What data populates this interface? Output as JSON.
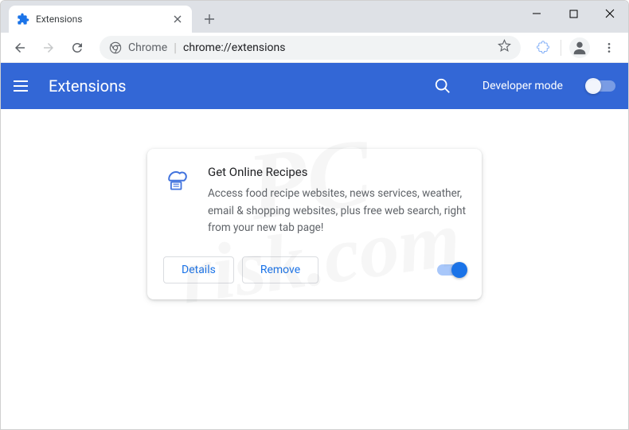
{
  "window": {
    "tab_title": "Extensions"
  },
  "omnibox": {
    "origin_label": "Chrome",
    "url": "chrome://extensions"
  },
  "header": {
    "title": "Extensions",
    "dev_mode_label": "Developer mode"
  },
  "extension": {
    "name": "Get Online Recipes",
    "description": "Access food recipe websites, news services, weather, email & shopping websites, plus free web search, right from your new tab page!",
    "details_label": "Details",
    "remove_label": "Remove",
    "enabled": true
  },
  "watermark": {
    "line1": "PC",
    "line2": "risk.com"
  }
}
